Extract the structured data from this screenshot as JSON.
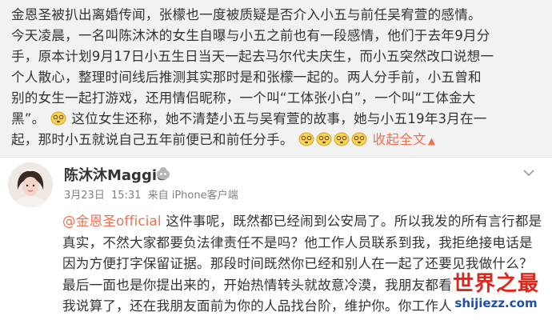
{
  "repost": {
    "lines": [
      "金恩圣被扒出离婚传闻，张檬也一度被质疑是否介入小五与前任吴宥萱的感情。",
      "今天凌晨，一名叫陈沐沐的女生自曝与小五之前也有一段感情，他们于去年9月分",
      "手，原本计划9月17日小五生日当天一起去马尔代夫庆生，而小五突然改口说想一",
      "个人散心，整理时间线后推测其实那时是和张檬一起的。两人分手前，小五曾和",
      "别的女生一起打游戏，还用情侣昵称，一个叫“工体张小白”，一个叫“工体金大",
      "黑”。",
      "这位女生还称，她不清楚小五与吴宥萱的故事，她与小五19年3月在一",
      "起，那时小五就说自己五年前便已和前任分手。"
    ],
    "expand_label": "收起全文",
    "emoji_icon": "dizzy-face-emoji"
  },
  "comment": {
    "author": "陈沐沐Maggie",
    "verify_icon": "weibo-member-icon",
    "date": "3月23日",
    "time": "15:31",
    "source": "来自 iPhone客户端",
    "mention": "@金恩圣official",
    "lines": [
      " 这件事呢，既然都已经闹到公安局了。所以我发的所有言行都是",
      "真实，不然大家都要负法律责任不是吗？他工作人员联系到我，我拒绝接电话是",
      "因为方便打字保留证据。那段时间既然你已经和别人在一起了还要见我做什么？",
      "最后一面也是你提出来的，开始热情转头就故意冷漠，我朋友都看",
      "我说算了，还在我朋友面前为你的人品找台阶，维护你。你工作人"
    ]
  },
  "watermark": {
    "title": "世界之最",
    "url": "shijiezz.com"
  },
  "colors": {
    "link": "#eb7350",
    "repost_bg": "#f2f2f2",
    "watermark_red": "#e0261a",
    "watermark_blue": "#1f4fa8"
  }
}
